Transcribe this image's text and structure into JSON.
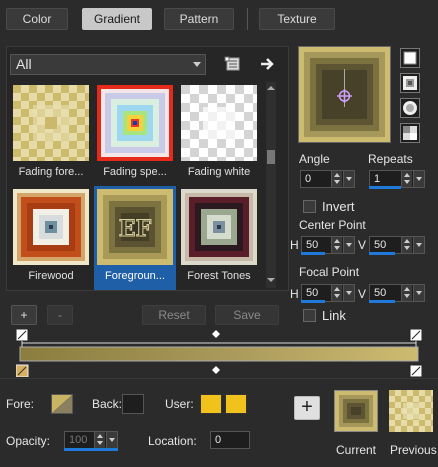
{
  "tabs": [
    {
      "label": "Color",
      "active": false
    },
    {
      "label": "Gradient",
      "active": true
    },
    {
      "label": "Pattern",
      "active": false
    },
    {
      "label": "Texture",
      "active": false
    }
  ],
  "category_dropdown": {
    "value": "All"
  },
  "gradients": [
    {
      "label": "Fading fore...",
      "selected": false
    },
    {
      "label": "Fading spe...",
      "selected": false
    },
    {
      "label": "Fading white",
      "selected": false
    },
    {
      "label": "Firewood",
      "selected": false
    },
    {
      "label": "Foregroun...",
      "selected": true
    },
    {
      "label": "Forest Tones",
      "selected": false
    }
  ],
  "angle": {
    "label": "Angle",
    "value": "0"
  },
  "repeats": {
    "label": "Repeats",
    "value": "1"
  },
  "invert": {
    "label": "Invert",
    "checked": false
  },
  "center_point": {
    "label": "Center Point",
    "h_label": "H",
    "h": "50",
    "v_label": "V",
    "v": "50"
  },
  "focal_point": {
    "label": "Focal Point",
    "h_label": "H",
    "h": "50",
    "v_label": "V",
    "v": "50"
  },
  "link": {
    "label": "Link",
    "checked": false
  },
  "editor_buttons": {
    "add": "+",
    "remove": "-",
    "reset": "Reset",
    "save": "Save"
  },
  "bottom": {
    "fore_label": "Fore:",
    "back_label": "Back:",
    "user_label": "User:",
    "opacity_label": "Opacity:",
    "opacity_value": "100",
    "location_label": "Location:",
    "location_value": "0",
    "add_button": "+",
    "current_label": "Current",
    "previous_label": "Previous"
  },
  "colors": {
    "accent": "#1f5fa8",
    "gold": "#c8b462",
    "dark_olive": "#3f3b26",
    "user_yellow": "#f1c21b"
  }
}
